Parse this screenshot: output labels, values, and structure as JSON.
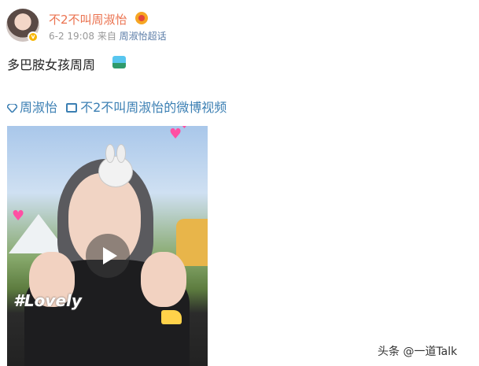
{
  "post": {
    "username": "不2不叫周淑怡",
    "timestamp": "6-2 19:08",
    "source_prefix": "来自",
    "source_topic": "周淑怡超话",
    "text": "多巴胺女孩周周",
    "verified_icon": "verified-badge-icon",
    "emoji_icon": "landscape-emoji-icon"
  },
  "links": {
    "topic_icon": "diamond-icon",
    "topic": "周淑怡",
    "video_icon": "video-icon",
    "video": "不2不叫周淑怡的微博视频"
  },
  "video": {
    "overlay_text": "#Lovely",
    "play_icon": "play-icon"
  },
  "watermark": {
    "text": "头条 @一道Talk"
  },
  "colors": {
    "username": "#eb7350",
    "link": "#3b7fb3",
    "meta": "#999999"
  }
}
